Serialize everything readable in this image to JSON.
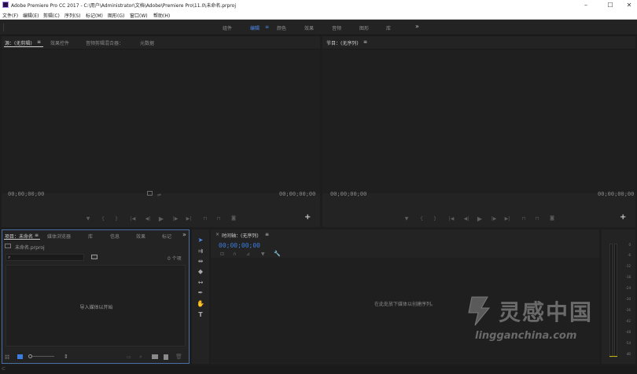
{
  "window": {
    "title": "Adobe Premiere Pro CC 2017 - C:\\用户\\Administrator\\文档\\Adobe\\Premiere Pro\\11.0\\未命名.prproj",
    "controls": [
      "–",
      "☐",
      "✕"
    ]
  },
  "menu": [
    "文件(F)",
    "编辑(E)",
    "剪辑(C)",
    "序列(S)",
    "标记(M)",
    "图形(G)",
    "窗口(W)",
    "帮助(H)"
  ],
  "workspaces": {
    "items": [
      "组件",
      "编辑",
      "颜色",
      "效果",
      "音频",
      "图形",
      "库"
    ],
    "active_index": 1,
    "menu_glyph": "≡",
    "more": "»"
  },
  "source_panel": {
    "tabs": [
      "源：(无剪辑)",
      "效果控件",
      "音频剪辑混合器：",
      "元数据"
    ],
    "active_index": 0,
    "menu_glyph": "≡",
    "timecode_left": "00;00;00;00",
    "timecode_right": "00;00;00;00",
    "add": "+"
  },
  "program_panel": {
    "title": "节目：(无序列)",
    "menu_glyph": "≡",
    "timecode_left": "00;00;00;00",
    "timecode_right": "00;00;00;00",
    "add": "+"
  },
  "project_panel": {
    "tabs": [
      "项目：未命名",
      "媒体浏览器",
      "库",
      "信息",
      "效果",
      "标记"
    ],
    "active_index": 0,
    "menu_glyph": "≡",
    "more": "»",
    "file": "未命名.prproj",
    "item_count": "0 个项",
    "empty_hint": "导入媒体以开始"
  },
  "timeline_panel": {
    "close": "×",
    "title": "时间轴：(无序列)",
    "menu_glyph": "≡",
    "timecode": "00;00;00;00",
    "empty_hint": "在此处放下媒体以创建序列。"
  },
  "meter": {
    "ticks": [
      "0",
      "-6",
      "-12",
      "-18",
      "-24",
      "-30",
      "-36",
      "-42",
      "-48",
      "-54",
      "dB"
    ]
  },
  "watermark": {
    "title": "灵感中国",
    "url": "lingganchina.com"
  },
  "colors": {
    "accent": "#3d7de0",
    "panel_bg": "#232323",
    "background": "#1d1d1d",
    "active_panel_border": "#4a6fa5"
  },
  "icons": {
    "tools": [
      "selection-tool-icon",
      "track-select-tool-icon",
      "ripple-edit-tool-icon",
      "razor-tool-icon",
      "slip-tool-icon",
      "pen-tool-icon",
      "hand-tool-icon",
      "type-tool-icon"
    ]
  }
}
